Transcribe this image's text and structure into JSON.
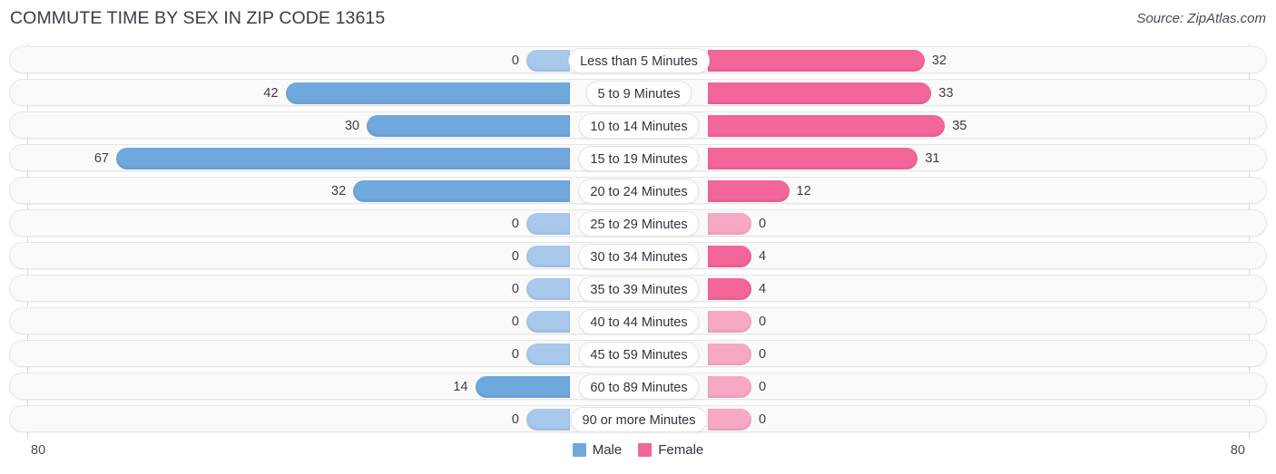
{
  "header": {
    "title": "COMMUTE TIME BY SEX IN ZIP CODE 13615",
    "source": "Source: ZipAtlas.com"
  },
  "legend": {
    "items": [
      {
        "label": "Male",
        "color": "#6fa8dc"
      },
      {
        "label": "Female",
        "color": "#f2669a"
      }
    ]
  },
  "axis": {
    "left_tick": "80",
    "right_tick": "80"
  },
  "colors": {
    "male_strong": "#6fa8dc",
    "male_light": "#a8c8ec",
    "female_strong": "#f2669a",
    "female_light": "#f7a8c4",
    "row_background": "#fafafa",
    "row_border": "#e6e6e6"
  },
  "chart_data": {
    "type": "bar",
    "orientation": "horizontal-diverging",
    "title": "COMMUTE TIME BY SEX IN ZIP CODE 13615",
    "xlabel": "",
    "ylabel": "",
    "xlim": [
      80,
      80
    ],
    "axis_max": 80,
    "grid": false,
    "legend_position": "bottom-center",
    "categories": [
      "Less than 5 Minutes",
      "5 to 9 Minutes",
      "10 to 14 Minutes",
      "15 to 19 Minutes",
      "20 to 24 Minutes",
      "25 to 29 Minutes",
      "30 to 34 Minutes",
      "35 to 39 Minutes",
      "40 to 44 Minutes",
      "45 to 59 Minutes",
      "60 to 89 Minutes",
      "90 or more Minutes"
    ],
    "series": [
      {
        "name": "Male",
        "side": "left",
        "values": [
          0,
          42,
          30,
          67,
          32,
          0,
          0,
          0,
          0,
          0,
          14,
          0
        ],
        "labels": [
          "0",
          "42",
          "30",
          "67",
          "32",
          "0",
          "0",
          "0",
          "0",
          "0",
          "14",
          "0"
        ]
      },
      {
        "name": "Female",
        "side": "right",
        "values": [
          32,
          33,
          35,
          31,
          12,
          0,
          4,
          4,
          0,
          0,
          0,
          0
        ],
        "labels": [
          "32",
          "33",
          "35",
          "31",
          "12",
          "0",
          "4",
          "4",
          "0",
          "0",
          "0",
          "0"
        ]
      }
    ]
  }
}
